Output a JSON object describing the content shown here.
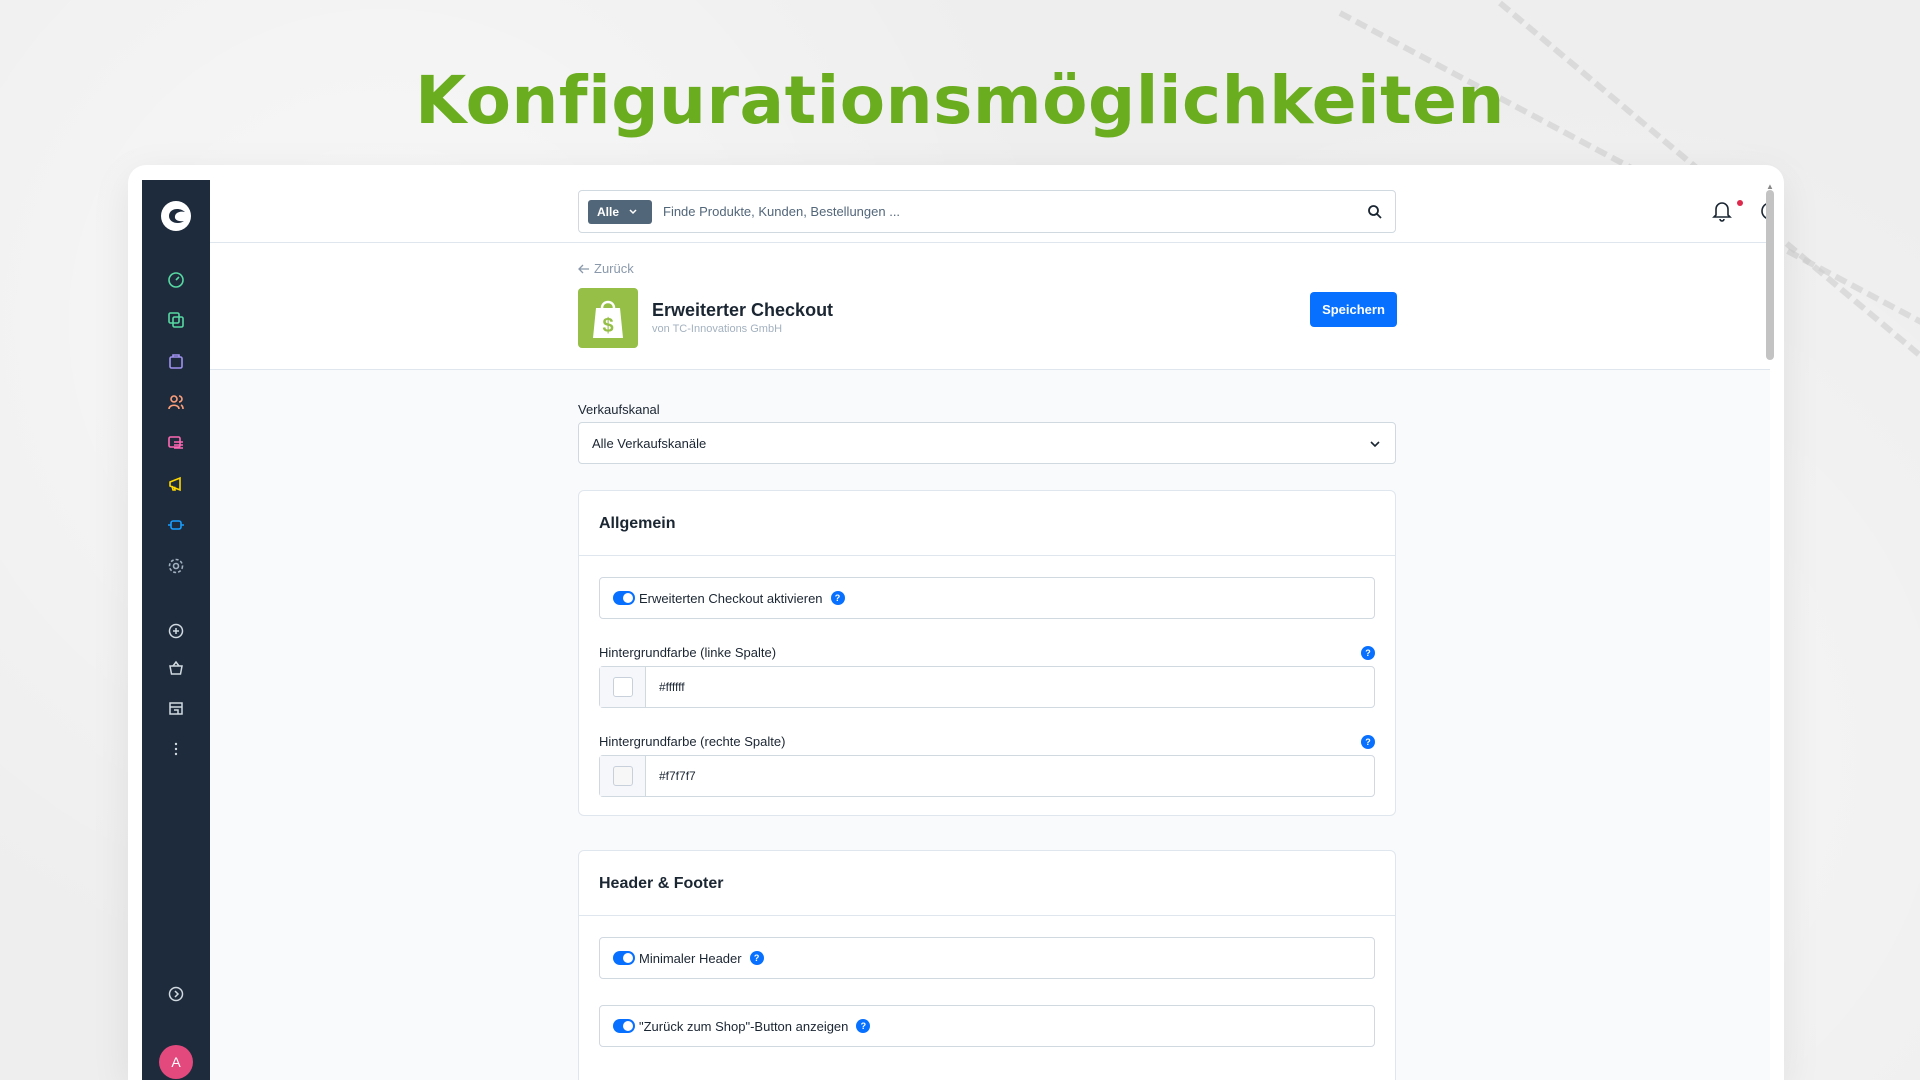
{
  "headline": "Konfigurationsmöglichkeiten",
  "topbar": {
    "search_category": "Alle",
    "search_placeholder": "Finde Produkte, Kunden, Bestellungen ..."
  },
  "header": {
    "back_label": "Zurück",
    "plugin_title": "Erweiterter Checkout",
    "plugin_vendor": "von TC-Innovations GmbH",
    "save_label": "Speichern"
  },
  "sales_channel": {
    "label": "Verkaufskanal",
    "selected": "Alle Verkaufskanäle"
  },
  "sections": {
    "general": {
      "title": "Allgemein",
      "enable_label": "Erweiterten Checkout aktivieren",
      "enable_on": true,
      "bg_left_label": "Hintergrundfarbe (linke Spalte)",
      "bg_left_value": "#ffffff",
      "bg_right_label": "Hintergrundfarbe (rechte Spalte)",
      "bg_right_value": "#f7f7f7"
    },
    "header_footer": {
      "title": "Header & Footer",
      "minimal_header_label": "Minimaler Header",
      "minimal_header_on": true,
      "back_to_shop_label": "\"Zurück zum Shop\"-Button anzeigen",
      "back_to_shop_on": true
    }
  },
  "sidebar": {
    "avatar_initial": "A",
    "icons": [
      "dashboard-icon",
      "catalog-icon",
      "orders-icon",
      "customers-icon",
      "content-icon",
      "marketing-icon",
      "extensions-icon",
      "settings-icon",
      "add-icon",
      "basket-icon",
      "store-icon",
      "more-icon",
      "collapse-icon"
    ]
  },
  "colors": {
    "accent": "#0870ff",
    "headline_green": "#6aad1f",
    "sidebar_bg": "#1e2b3c",
    "avatar_bg": "#e3497d"
  }
}
